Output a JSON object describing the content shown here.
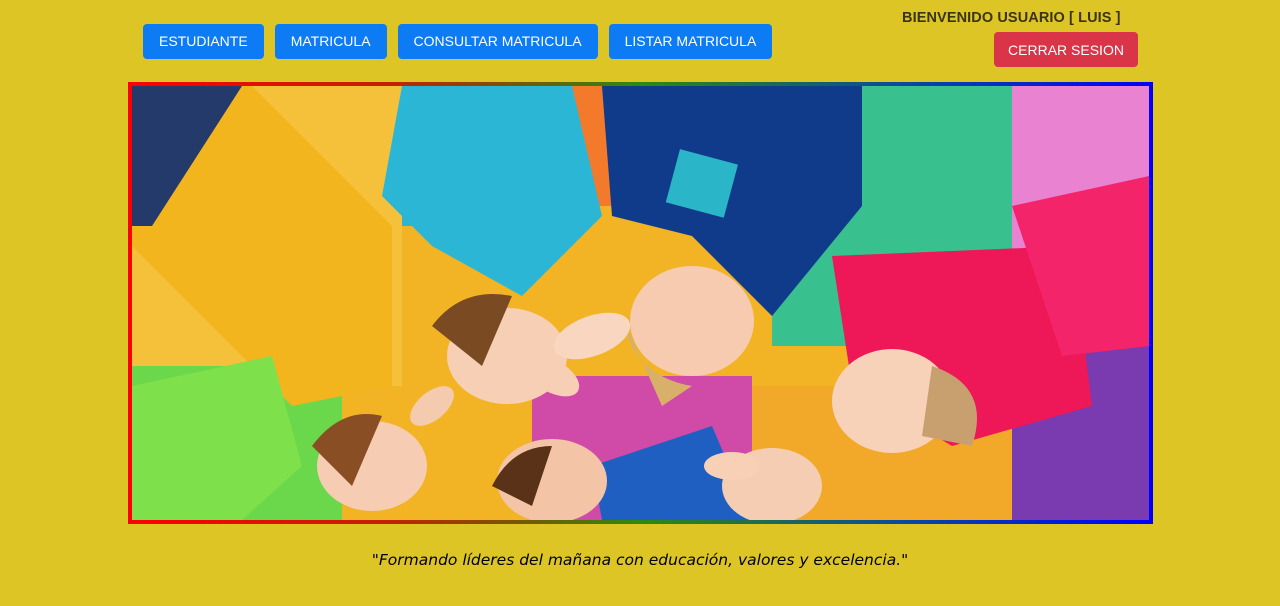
{
  "nav": {
    "buttons": [
      {
        "label": "ESTUDIANTE"
      },
      {
        "label": "MATRICULA"
      },
      {
        "label": "CONSULTAR MATRICULA"
      },
      {
        "label": "LISTAR MATRICULA"
      }
    ]
  },
  "header": {
    "welcome_text": "BIENVENIDO USUARIO [ LUIS ]",
    "logout_label": "CERRAR SESION"
  },
  "banner": {
    "image_description": "Children in colorful t-shirts lying in a circle on colorful foam mats, smiling, with hands raised toward the center",
    "border_colors": [
      "#ff0000",
      "#2e8a0e",
      "#0000ff"
    ]
  },
  "footer": {
    "tagline": "\"Formando líderes del mañana con educación, valores y excelencia.\""
  },
  "colors": {
    "background": "#dec526",
    "nav_button": "#0d7bf4",
    "logout_button": "#d93448"
  }
}
